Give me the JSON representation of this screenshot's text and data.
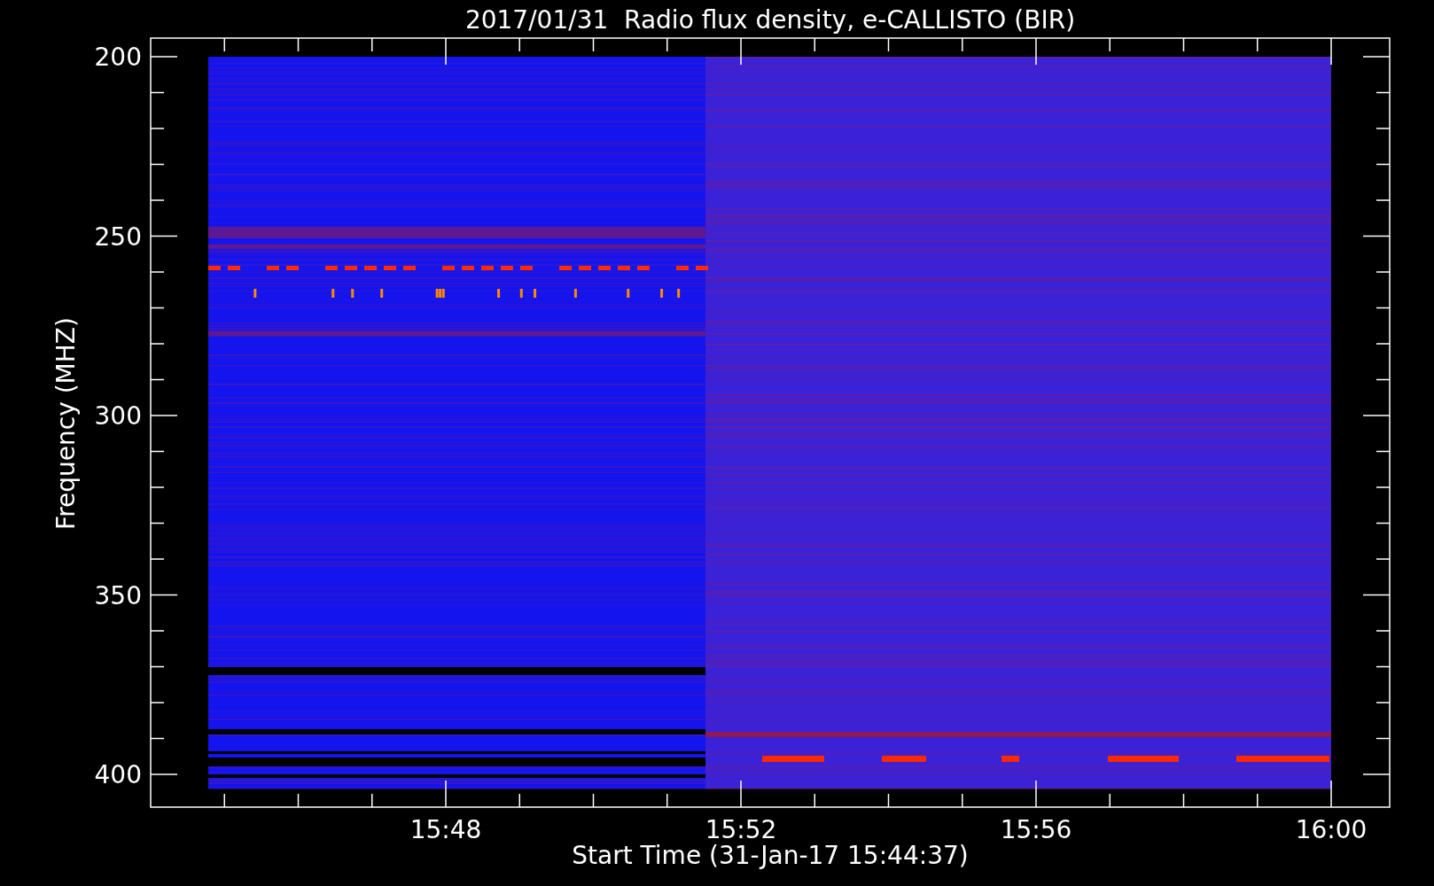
{
  "title": "2017/01/31  Radio flux density, e-CALLISTO (BIR)",
  "y_axis": {
    "label": "Frequency (MHZ)",
    "ticks": [
      "200",
      "250",
      "300",
      "350",
      "400"
    ]
  },
  "x_axis": {
    "label": "Start Time (31-Jan-17 15:44:37)",
    "ticks": [
      "15:48",
      "15:52",
      "15:56",
      "16:00"
    ]
  }
}
